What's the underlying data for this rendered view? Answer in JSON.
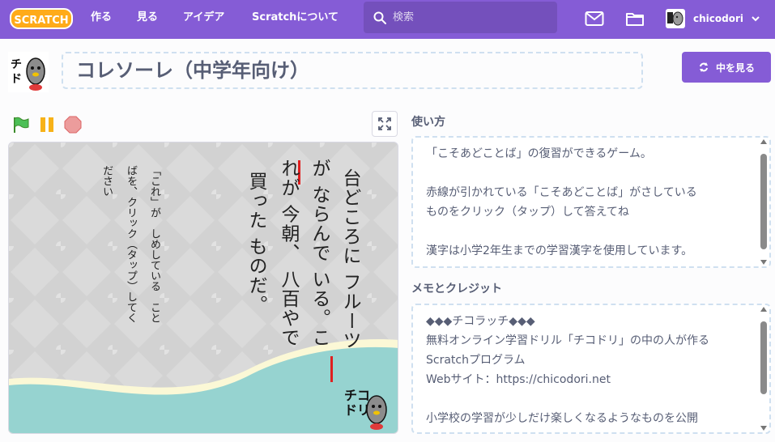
{
  "nav": {
    "logo_text": "SCRATCH",
    "links": [
      "作る",
      "見る",
      "アイデア",
      "Scratchについて"
    ],
    "search_placeholder": "検索",
    "username": "chicodori"
  },
  "project": {
    "title": "コレソーレ（中学年向け）",
    "see_inside_label": "中を見る"
  },
  "stage": {
    "column1": "台どころに フルーツ",
    "column2": "が ならんで いる。こ",
    "column3": "れが 今朝、 八百やで",
    "column4": "買った ものだ。",
    "instruction_col1": "「これ」が　しめしている　こと",
    "instruction_col2": "ばを、クリック（タップ）してく",
    "instruction_col3": "ださい",
    "logo_text": "チコ\nドリ"
  },
  "instructions": {
    "title": "使い方",
    "text": "「こそあどことば」の復習ができるゲーム。\n\n赤線が引かれている「こそあどことば」がさしている\nものをクリック（タップ）して答えてね\n\n漢字は小学2年生までの学習漢字を使用しています。"
  },
  "notes": {
    "title": "メモとクレジット",
    "text": "◆◆◆チコラッチ◆◆◆\n無料オンライン学習ドリル「チコドリ」の中の人が作る\nScratchプログラム\nWebサイト：https://chicodori.net\n\n小学校の学習が少しだけ楽しくなるようなものを公開"
  },
  "colors": {
    "brand": "#855cd6",
    "text": "#575e75",
    "stage_wave": "#96d3d0",
    "stage_cream": "#fbf8d6",
    "underline_red": "#e02020"
  }
}
